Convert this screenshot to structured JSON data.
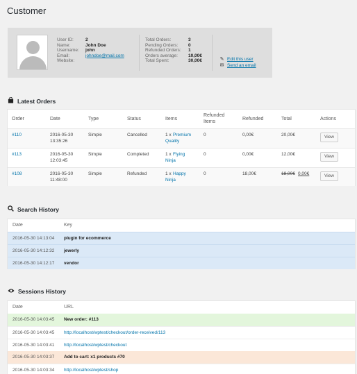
{
  "page_title": "Customer",
  "profile": {
    "user_id_label": "User ID:",
    "user_id": "2",
    "name_label": "Name:",
    "name": "John Doe",
    "username_label": "Username:",
    "username": "john",
    "email_label": "Email:",
    "email": "johndoe@mail.com",
    "website_label": "Website:",
    "website": "",
    "total_orders_label": "Total Orders:",
    "total_orders": "3",
    "pending_orders_label": "Pending Orders:",
    "pending_orders": "0",
    "refunded_orders_label": "Refunded Orders:",
    "refunded_orders": "1",
    "orders_average_label": "Orders average:",
    "orders_average": "10,00€",
    "total_spent_label": "Total Spent:",
    "total_spent": "30,00€",
    "edit_user": "Edit this user",
    "send_email": "Send an email"
  },
  "latest_orders": {
    "title": "Latest Orders",
    "headers": {
      "order": "Order",
      "date": "Date",
      "type": "Type",
      "status": "Status",
      "items": "Items",
      "refunded_items_1": "Refunded",
      "refunded_items_2": "Items",
      "refunded": "Refunded",
      "total": "Total",
      "actions": "Actions"
    },
    "rows": [
      {
        "order": "#110",
        "date": "2016-05-30",
        "time": "13:35:26",
        "type": "Simple",
        "status": "Cancelled",
        "items_qty": "1 x",
        "items_name_1": "Premium",
        "items_name_2": "Quality",
        "refunded_items": "0",
        "refunded": "0,00€",
        "total": "20,00€",
        "total_old": "",
        "action": "View"
      },
      {
        "order": "#113",
        "date": "2016-05-30",
        "time": "12:03:45",
        "type": "Simple",
        "status": "Completed",
        "items_qty": "1 x",
        "items_name_1": "Flying",
        "items_name_2": "Ninja",
        "refunded_items": "0",
        "refunded": "0,00€",
        "total": "12,00€",
        "total_old": "",
        "action": "View"
      },
      {
        "order": "#108",
        "date": "2016-05-30",
        "time": "11:48:00",
        "type": "Simple",
        "status": "Refunded",
        "items_qty": "1 x",
        "items_name_1": "Happy",
        "items_name_2": "Ninja",
        "refunded_items": "0",
        "refunded": "18,00€",
        "total": "0,00€",
        "total_old": "18,00€",
        "action": "View"
      }
    ]
  },
  "search_history": {
    "title": "Search History",
    "headers": {
      "date": "Date",
      "key": "Key"
    },
    "rows": [
      {
        "date": "2016-05-30 14:13:04",
        "key": "plugin for ecommerce"
      },
      {
        "date": "2016-05-30 14:12:32",
        "key": "jewerly"
      },
      {
        "date": "2016-05-30 14:12:17",
        "key": "vendor"
      }
    ]
  },
  "sessions_history": {
    "title": "Sessions History",
    "headers": {
      "date": "Date",
      "url": "URL"
    },
    "rows": [
      {
        "date": "2016-05-30 14:03:45",
        "url": "New order: #113"
      },
      {
        "date": "2016-05-30 14:03:45",
        "url": "http://localhost/wptest/checkout/order-received/113"
      },
      {
        "date": "2016-05-30 14:03:41",
        "url": "http://localhost/wptest/checkout"
      },
      {
        "date": "2016-05-30 14:03:37",
        "url": "Add to cart: x1 products #70"
      },
      {
        "date": "2016-05-30 14:03:34",
        "url": "http://localhost/wptest/shop"
      }
    ]
  },
  "icons": {
    "orders": "shopping-bag-icon",
    "search": "search-icon",
    "sessions": "eye-icon",
    "edit": "pencil-icon",
    "email": "envelope-icon"
  },
  "colors": {
    "link": "#0073aa",
    "search_row": "#dbe9f7",
    "order_row": "#e3f6dc",
    "cart_row": "#fbe7d8"
  }
}
